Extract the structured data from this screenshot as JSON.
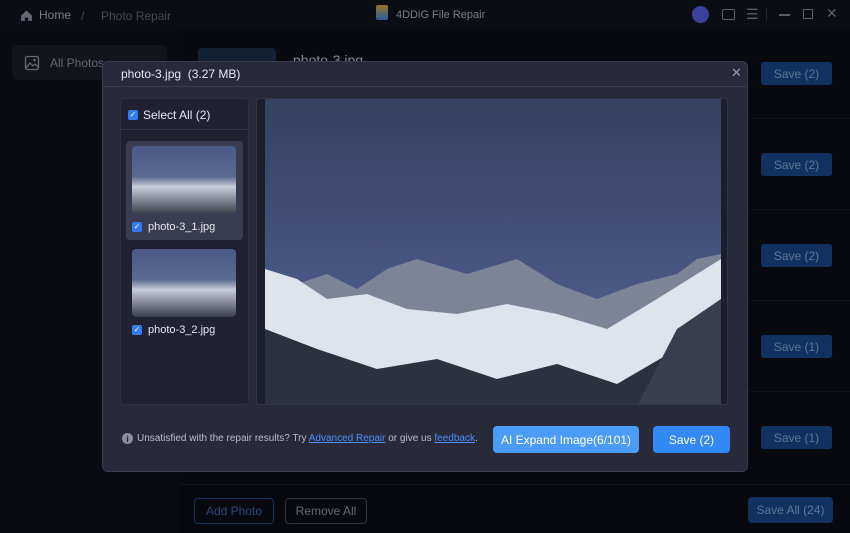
{
  "titlebar": {
    "home": "Home",
    "separator": "/",
    "breadcrumb": "Photo Repair",
    "app_title": "4DDiG File Repair"
  },
  "sidebar": {
    "items": [
      {
        "label": "All Photos"
      }
    ]
  },
  "main": {
    "first_file": "photo-3.jpg",
    "row_saves": [
      "Save (2)",
      "Save (2)",
      "Save (2)",
      "Save (1)",
      "Save (1)"
    ]
  },
  "bottom": {
    "add_photo": "Add Photo",
    "remove_all": "Remove All",
    "save_all": "Save All (24)"
  },
  "modal": {
    "title": "photo-3.jpg",
    "size": "(3.27 MB)",
    "select_all": "Select All (2)",
    "thumbs": [
      {
        "name": "photo-3_1.jpg",
        "checked": true
      },
      {
        "name": "photo-3_2.jpg",
        "checked": true
      }
    ],
    "footer": {
      "text1": "Unsatisfied with the repair results? Try ",
      "link1": "Advanced Repair",
      "text2": " or give us ",
      "link2": "feedback",
      "text3": "."
    },
    "ai_expand": "AI Expand Image(6/101)",
    "save": "Save (2)"
  },
  "colors": {
    "accent": "#3289f6",
    "modal_bg": "#282a3a"
  }
}
